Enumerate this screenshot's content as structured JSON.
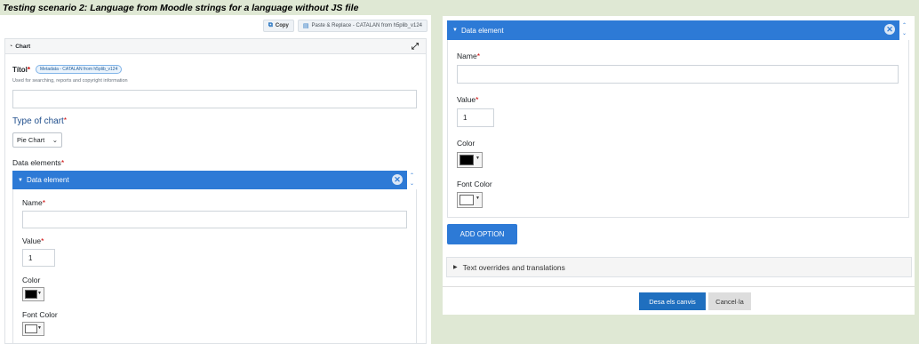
{
  "scenario_title": "Testing scenario 2: Language from Moodle strings for a language without JS file",
  "toolbar": {
    "copy_label": "Copy",
    "paste_label": "Paste & Replace - CATALAN from h5plib_v124"
  },
  "chart": {
    "header": "Chart",
    "title_label": "Títol",
    "metadata_badge": "Metadata - CATALAN from h5plib_v124",
    "title_description": "Used for searching, reports and copyright information",
    "title_value": "",
    "type_label": "Type of chart",
    "type_value": "Pie Chart",
    "data_elements_label": "Data elements"
  },
  "data_element": {
    "header": "Data element",
    "name_label": "Name",
    "name_value": "",
    "value_label": "Value",
    "value_value": "1",
    "color_label": "Color",
    "color_value": "#000000",
    "font_color_label": "Font Color",
    "font_color_value": "#ffffff"
  },
  "add_option_label": "ADD OPTION",
  "overrides_label": "Text overrides and translations",
  "footer": {
    "save_label": "Desa els canvis",
    "cancel_label": "Cancel·la"
  },
  "colors": {
    "accent": "#2d7ad6",
    "save": "#1f6fbf",
    "required": "#cc0000",
    "background": "#dfe8d4"
  }
}
